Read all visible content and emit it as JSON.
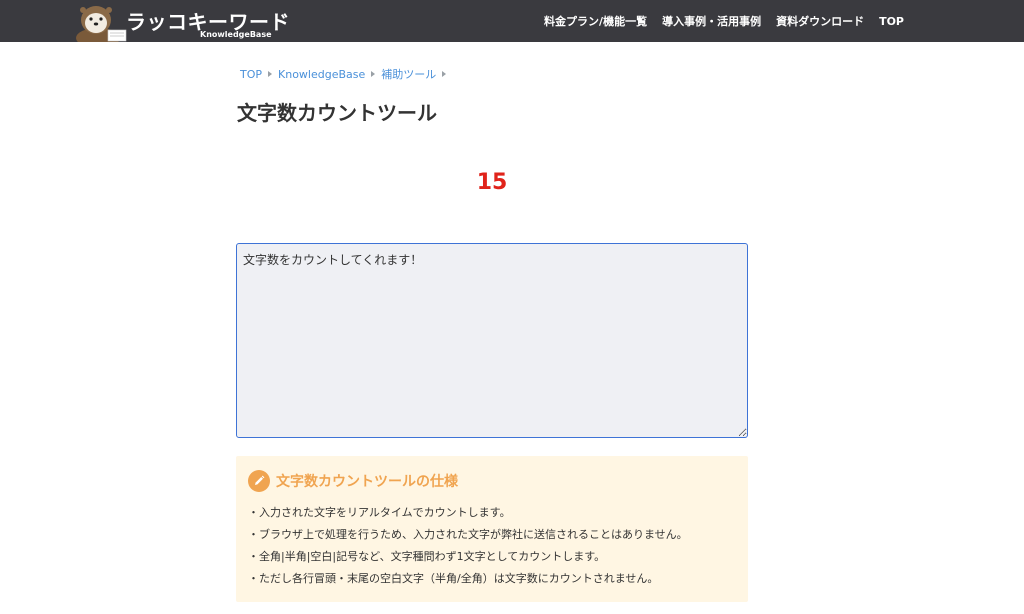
{
  "header": {
    "logo_title": "ラッコキーワード",
    "logo_subtitle": "KnowledgeBase",
    "logo_icon": "sea-otter-mascot",
    "nav": [
      "料金プラン/機能一覧",
      "導入事例・活用事例",
      "資料ダウンロード",
      "TOP"
    ]
  },
  "breadcrumb": [
    "TOP",
    "KnowledgeBase",
    "補助ツール"
  ],
  "page": {
    "title": "文字数カウントツール"
  },
  "counter": {
    "value": "15"
  },
  "input": {
    "value": "文字数をカウントしてくれます！"
  },
  "spec": {
    "icon": "pencil-icon",
    "title": "文字数カウントツールの仕様",
    "items": [
      "・入力された文字をリアルタイムでカウントします。",
      "・ブラウザ上で処理を行うため、入力された文字が弊社に送信されることはありません。",
      "・全角|半角|空白|記号など、文字種問わず1文字としてカウントします。",
      "・ただし各行冒頭・末尾の空白文字（半角/全角）は文字数にカウントされません。"
    ]
  },
  "colors": {
    "header_bg": "#3a3a3f",
    "link": "#4a90d9",
    "counter": "#e0231a",
    "accent_orange": "#f0a450",
    "spec_bg": "#fff6e3",
    "input_border": "#3e73d6"
  }
}
